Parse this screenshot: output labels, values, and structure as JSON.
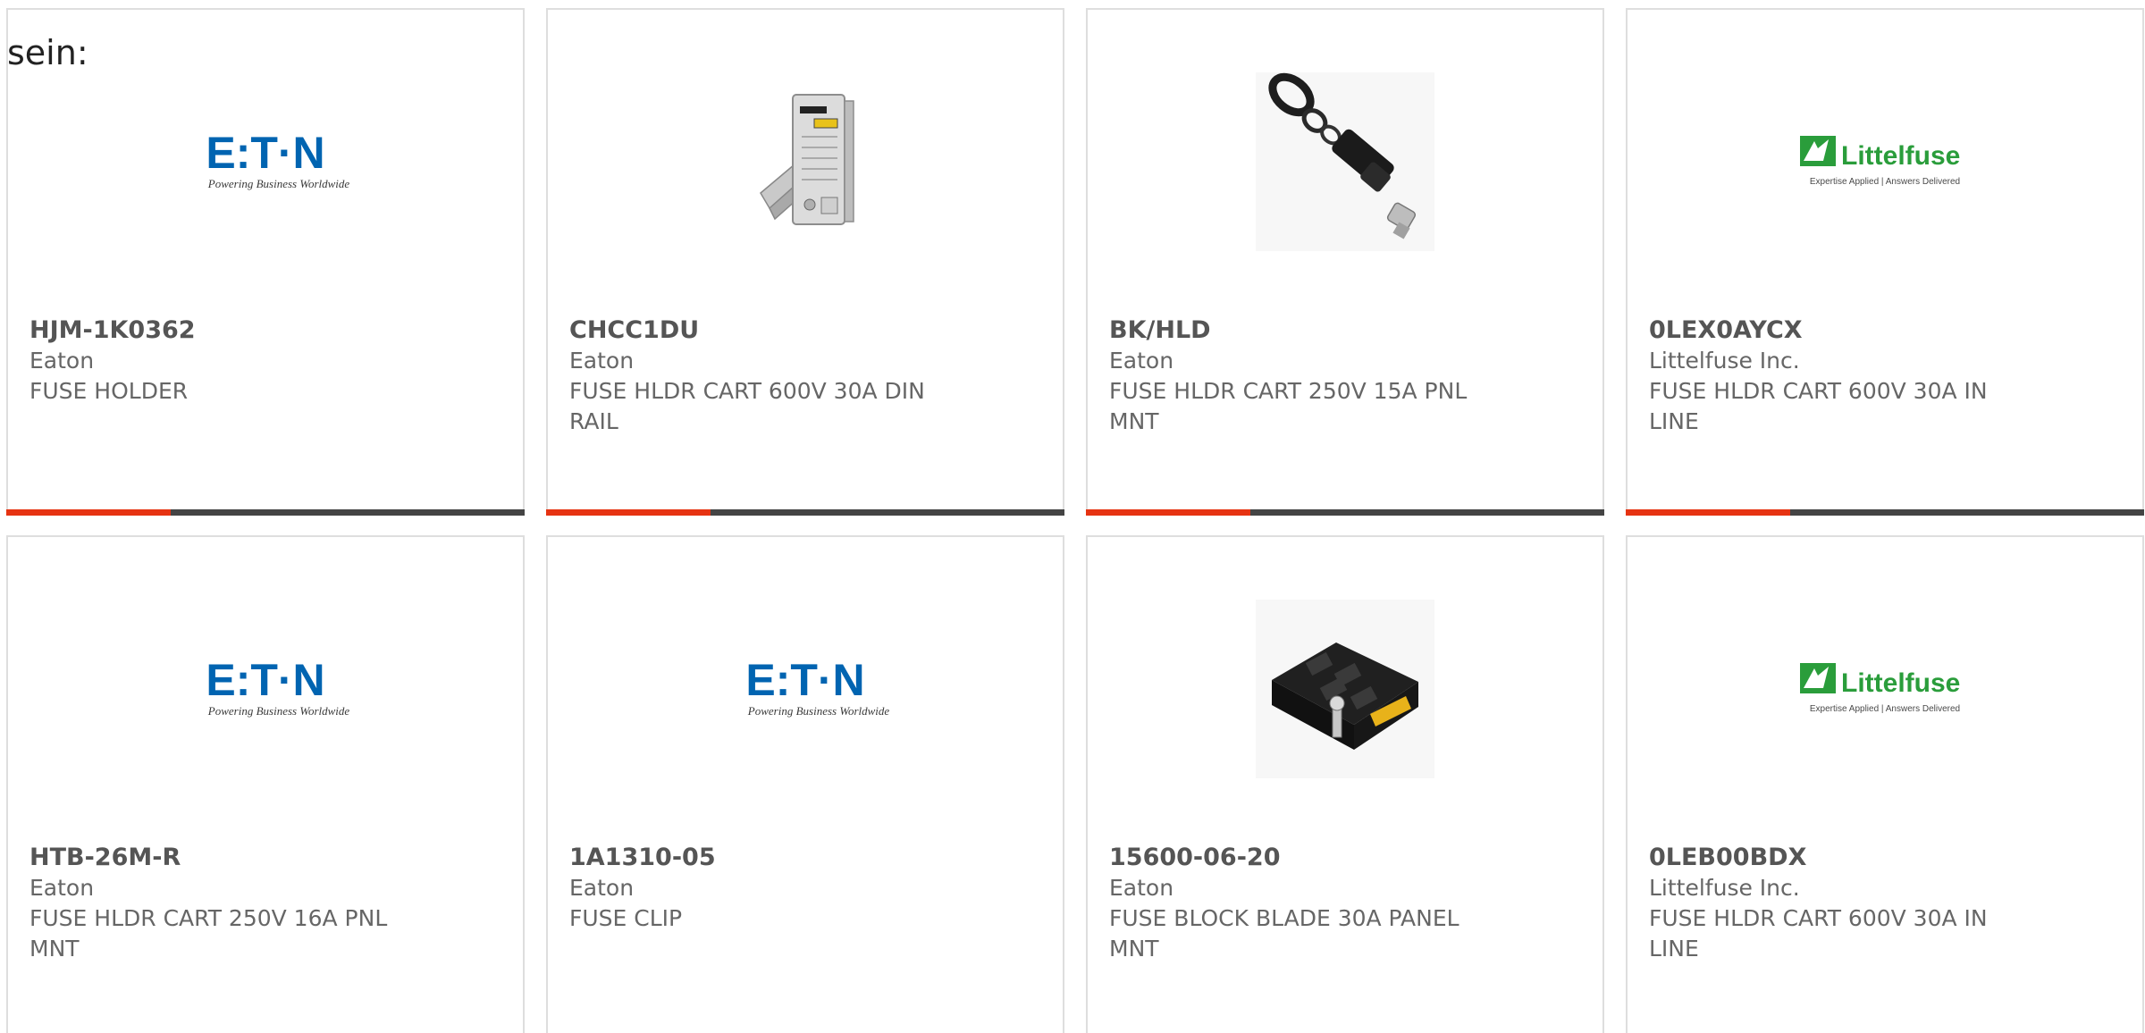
{
  "lead_text": "sein:",
  "colors": {
    "accent_bar": "#e63312",
    "base_bar": "#444444",
    "card_border": "#dedede",
    "eaton_blue": "#0064b1",
    "littelfuse_green": "#2a9d3b"
  },
  "products": [
    {
      "part_number": "HJM-1K0362",
      "manufacturer": "Eaton",
      "description": "FUSE HOLDER",
      "image": "eaton-logo",
      "logo": {
        "brand": "E:T·N",
        "tagline": "Powering Business Worldwide"
      }
    },
    {
      "part_number": "CHCC1DU",
      "manufacturer": "Eaton",
      "description": "FUSE HLDR CART 600V 30A DIN RAIL",
      "image": "din-rail-fuse-holder-photo"
    },
    {
      "part_number": "BK/HLD",
      "manufacturer": "Eaton",
      "description": "FUSE HLDR CART 250V 15A PNL MNT",
      "image": "panel-mount-fuse-holder-photo"
    },
    {
      "part_number": "0LEX0AYCX",
      "manufacturer": "Littelfuse Inc.",
      "description": "FUSE HLDR CART 600V 30A IN LINE",
      "image": "littelfuse-logo",
      "logo": {
        "brand": "Littelfuse",
        "tagline": "Expertise Applied | Answers Delivered"
      }
    },
    {
      "part_number": "HTB-26M-R",
      "manufacturer": "Eaton",
      "description": "FUSE HLDR CART 250V 16A PNL MNT",
      "image": "eaton-logo",
      "logo": {
        "brand": "E:T·N",
        "tagline": "Powering Business Worldwide"
      }
    },
    {
      "part_number": "1A1310-05",
      "manufacturer": "Eaton",
      "description": "FUSE CLIP",
      "image": "eaton-logo",
      "logo": {
        "brand": "E:T·N",
        "tagline": "Powering Business Worldwide"
      }
    },
    {
      "part_number": "15600-06-20",
      "manufacturer": "Eaton",
      "description": "FUSE BLOCK BLADE 30A PANEL MNT",
      "image": "fuse-block-photo"
    },
    {
      "part_number": "0LEB00BDX",
      "manufacturer": "Littelfuse Inc.",
      "description": "FUSE HLDR CART 600V 30A IN LINE",
      "image": "littelfuse-logo",
      "logo": {
        "brand": "Littelfuse",
        "tagline": "Expertise Applied | Answers Delivered"
      }
    }
  ]
}
